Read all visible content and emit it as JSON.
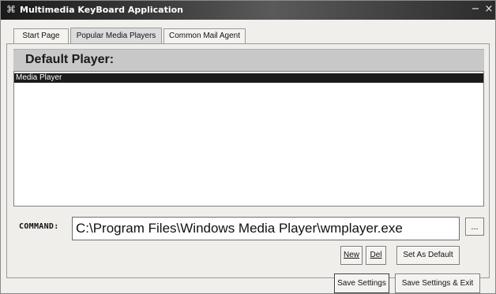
{
  "window": {
    "title": "Multimedia KeyBoard Application",
    "icon": "keyboard-icon",
    "minimize_glyph": "−",
    "close_glyph": "×"
  },
  "tabs": [
    {
      "label": "Start Page",
      "active": false
    },
    {
      "label": "Popular Media Players",
      "active": true
    },
    {
      "label": "Common Mail Agent",
      "active": false
    }
  ],
  "panel": {
    "header": "Default Player:",
    "players": [
      "Media Player"
    ],
    "selected_player": "Media Player",
    "command_label": "COMMAND:",
    "command_value": "C:\\Program Files\\Windows Media Player\\wmplayer.exe",
    "browse_label": "...",
    "new_label": "New",
    "del_label": "Del",
    "set_default_label": "Set As Default"
  },
  "footer": {
    "save_label": "Save Settings",
    "save_exit_label": "Save Settings & Exit"
  },
  "colors": {
    "selection": "#1c1c1c",
    "header_band": "#c8c8c8",
    "window_bg": "#f0efec"
  }
}
